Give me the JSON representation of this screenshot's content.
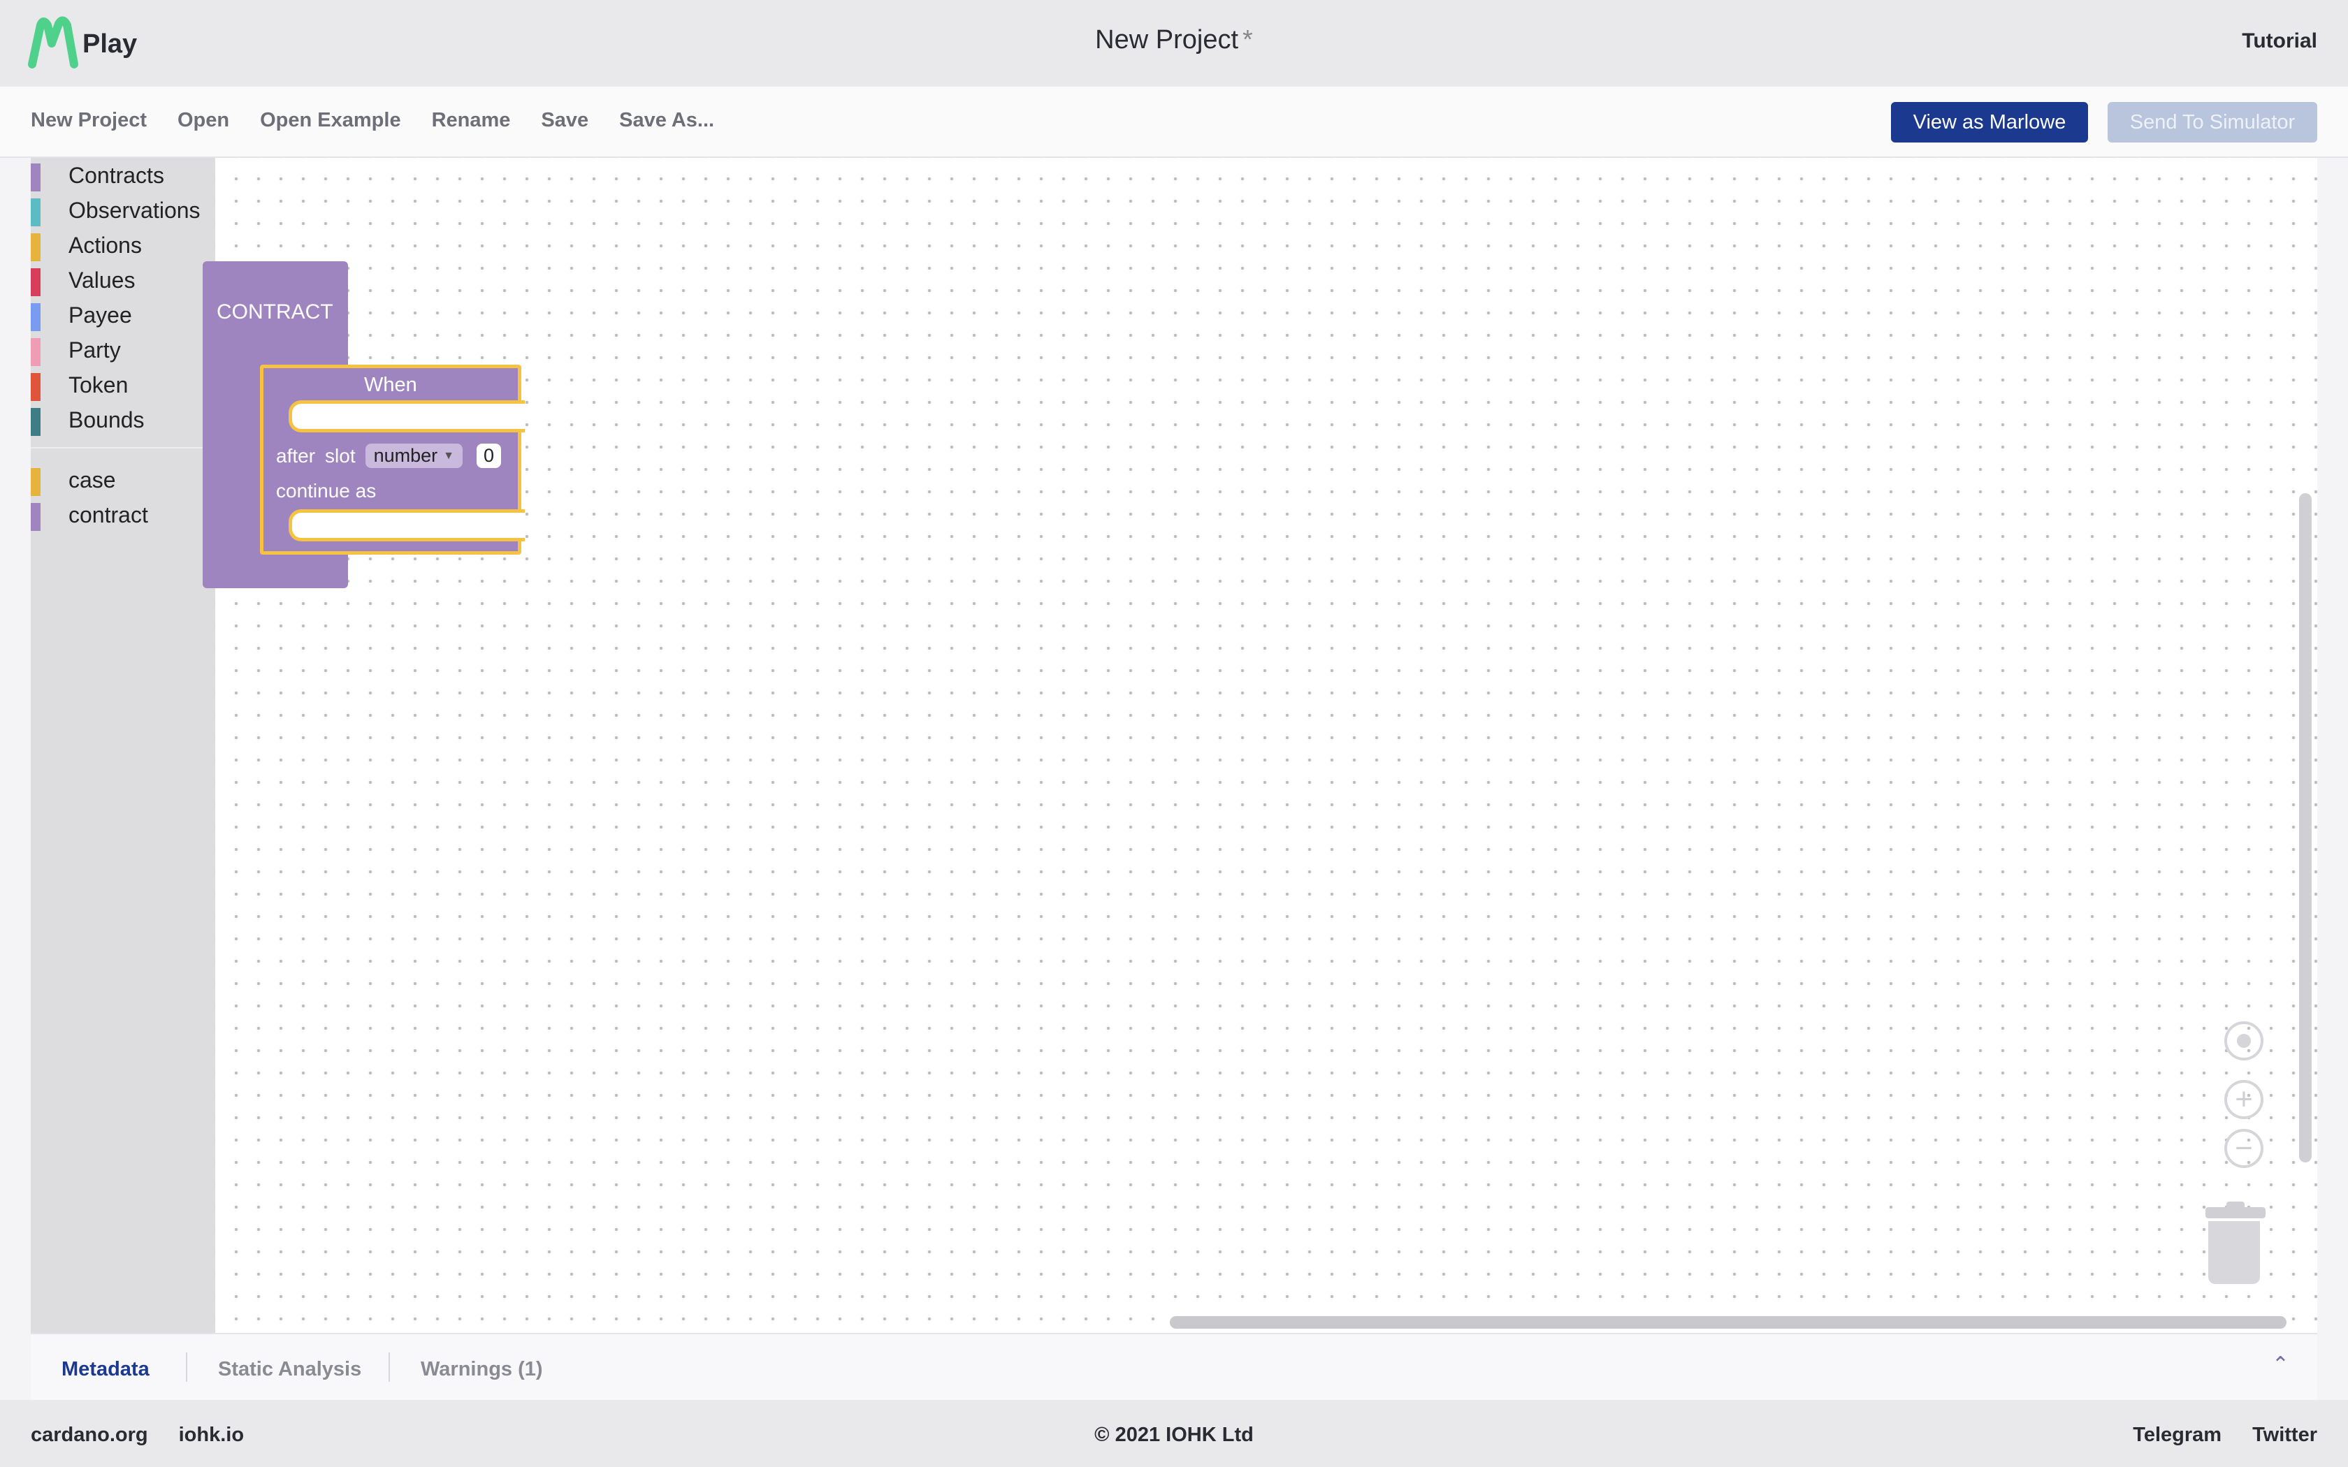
{
  "app": {
    "logo_text": "Play",
    "project_title": "New Project",
    "dirty_marker": "*",
    "tutorial_label": "Tutorial"
  },
  "toolbar": {
    "menu": [
      "New Project",
      "Open",
      "Open Example",
      "Rename",
      "Save",
      "Save As..."
    ],
    "view_as_marlowe_label": "View as Marlowe",
    "send_to_simulator_label": "Send To Simulator"
  },
  "toolbox": {
    "categories": [
      {
        "label": "Contracts",
        "color": "#9f85bf"
      },
      {
        "label": "Observations",
        "color": "#5cbcc4"
      },
      {
        "label": "Actions",
        "color": "#e6b43c"
      },
      {
        "label": "Values",
        "color": "#d93d5c"
      },
      {
        "label": "Payee",
        "color": "#7a9cf0"
      },
      {
        "label": "Party",
        "color": "#f09cb4"
      },
      {
        "label": "Token",
        "color": "#e0553a"
      },
      {
        "label": "Bounds",
        "color": "#3e7d86"
      }
    ],
    "extra": [
      {
        "label": "case",
        "color": "#e6b43c"
      },
      {
        "label": "contract",
        "color": "#9f85bf"
      }
    ]
  },
  "blocks": {
    "contract_label": "CONTRACT",
    "when_label": "When",
    "after_label": "after",
    "slot_label": "slot",
    "slot_type": "number",
    "slot_value": "0",
    "continue_label": "continue as"
  },
  "colors": {
    "block_purple": "#9f85bf",
    "highlight_yellow": "#f5c242",
    "primary_button": "#1b3a8f"
  },
  "bottom_tabs": {
    "tabs": [
      "Metadata",
      "Static Analysis",
      "Warnings (1)"
    ],
    "active": "Metadata"
  },
  "footer": {
    "left_links": [
      "cardano.org",
      "iohk.io"
    ],
    "copyright": "© 2021 IOHK Ltd",
    "right_links": [
      "Telegram",
      "Twitter"
    ]
  }
}
